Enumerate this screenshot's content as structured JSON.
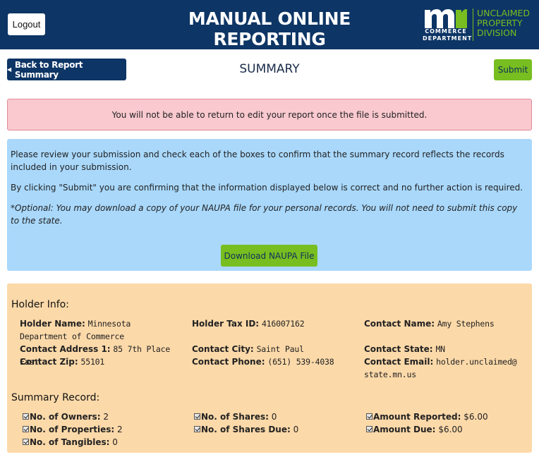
{
  "header": {
    "logout_label": "Logout",
    "title": "MANUAL ONLINE REPORTING",
    "logo_mn": "mn",
    "logo_commerce": "COMMERCE\nDEPARTMENT",
    "logo_unclaimed": "UNCLAIMED\nPROPERTY\nDIVISION"
  },
  "toolbar": {
    "back_label": "Back to Report Summary",
    "page_title": "SUMMARY",
    "submit_label": "Submit"
  },
  "warning_text": "You will not be able to return to edit your report once the file is submitted.",
  "info": {
    "p1": "Please review your submission and check each of the boxes to confirm that the summary record reflects the records included in your submission.",
    "p2": "By clicking \"Submit\" you are confirming that the information displayed below is correct and no further action is required.",
    "p3": "*Optional: You may download a copy of your NAUPA file for your personal records. You will not need to submit this copy to the state.",
    "download_label": "Download NAUPA File"
  },
  "holder": {
    "section_title": "Holder Info:",
    "name_label": "Holder Name:",
    "name_value": "Minnesota Department of Commerce",
    "tax_label": "Holder Tax ID:",
    "tax_value": "416007162",
    "contact_name_label": "Contact Name:",
    "contact_name_value": "Amy Stephens",
    "address_label": "Contact Address 1:",
    "address_value": "85 7th Place East",
    "city_label": "Contact City:",
    "city_value": "Saint Paul",
    "state_label": "Contact State:",
    "state_value": "MN",
    "zip_label": "Contact Zip:",
    "zip_value": "55101",
    "phone_label": "Contact Phone:",
    "phone_value": "(651) 539-4038",
    "email_label": "Contact Email:",
    "email_value": "holder.unclaimed@state.mn.us"
  },
  "summary": {
    "section_title": "Summary Record:",
    "owners_label": "No. of Owners:",
    "owners_value": "2",
    "properties_label": "No. of Properties:",
    "properties_value": "2",
    "tangibles_label": "No. of Tangibles:",
    "tangibles_value": "0",
    "shares_label": "No. of Shares:",
    "shares_value": "0",
    "shares_due_label": "No. of Shares Due:",
    "shares_due_value": "0",
    "amount_reported_label": "Amount Reported:",
    "amount_reported_value": "$6.00",
    "amount_due_label": "Amount Due:",
    "amount_due_value": "$6.00"
  },
  "colors": {
    "header_bg": "#0d3565",
    "accent_green": "#78be20",
    "warning_bg": "#f9c9cf",
    "info_bg": "#a9d8fb",
    "holder_bg": "#fcd9a9"
  }
}
